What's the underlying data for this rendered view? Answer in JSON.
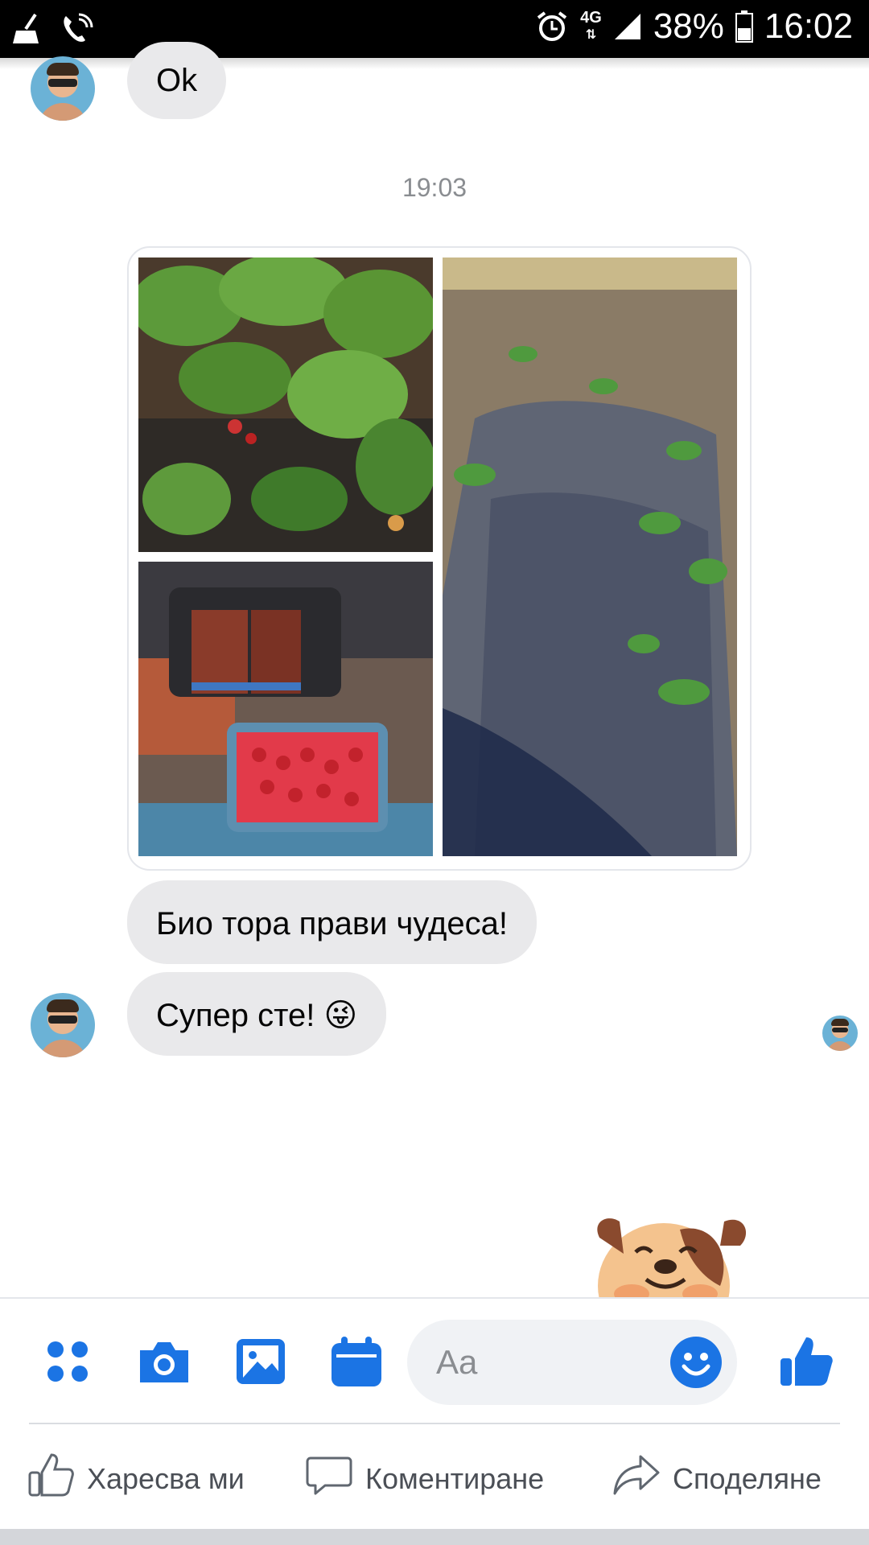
{
  "status_bar": {
    "network": "4G",
    "battery": "38%",
    "time": "16:02"
  },
  "chat": {
    "messages": [
      {
        "text": "Ok"
      },
      {
        "text": "Био тора прави чудеса!"
      },
      {
        "text": "Супер сте! 😜"
      }
    ],
    "timestamp": "19:03"
  },
  "composer": {
    "placeholder": "Aa",
    "icons": [
      "apps-icon",
      "camera-icon",
      "gallery-icon",
      "calendar-icon",
      "emoji-icon",
      "thumbs-up-icon"
    ],
    "accent": "#1b74e4"
  },
  "post_actions": {
    "like": "Харесва ми",
    "comment": "Коментиране",
    "share": "Споделяне"
  }
}
